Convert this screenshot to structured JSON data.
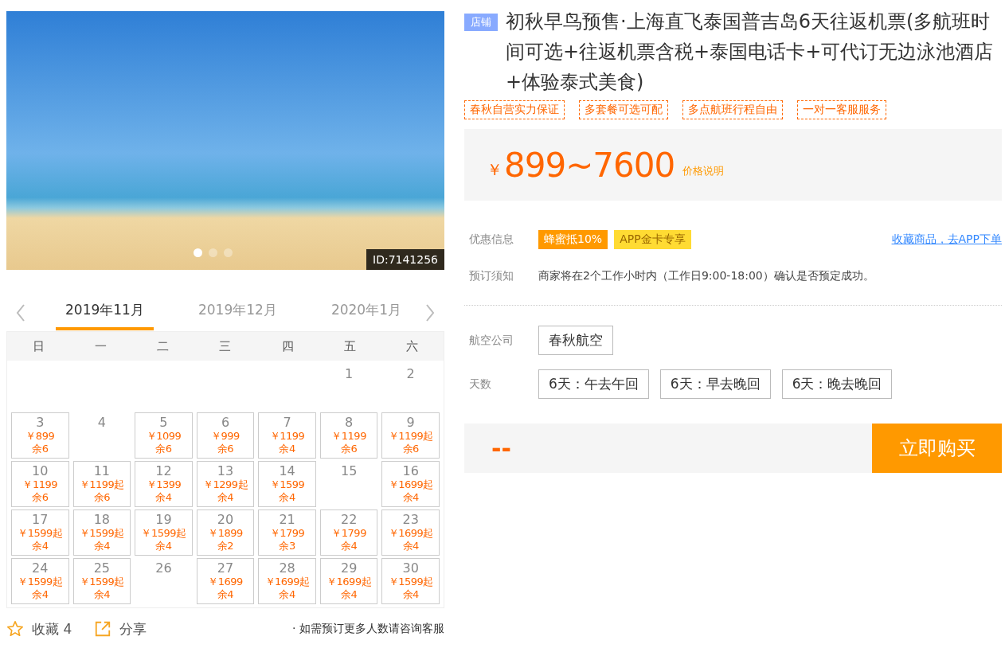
{
  "gallery": {
    "dots": [
      {
        "selected": true
      },
      {
        "selected": false
      },
      {
        "selected": false
      }
    ],
    "id_label": "ID:7141256"
  },
  "calendar": {
    "months": [
      {
        "label": "2019年11月",
        "selected": true
      },
      {
        "label": "2019年12月",
        "selected": false
      },
      {
        "label": "2020年1月",
        "selected": false
      }
    ],
    "weekdays": [
      "日",
      "一",
      "二",
      "三",
      "四",
      "五",
      "六"
    ],
    "weeks": [
      [
        {
          "day": "1"
        },
        {
          "day": "2"
        }
      ],
      [
        {
          "day": "3",
          "price": "￥899",
          "stock": "余6"
        },
        {
          "day": "4"
        },
        {
          "day": "5",
          "price": "￥1099",
          "stock": "余6"
        },
        {
          "day": "6",
          "price": "￥999",
          "stock": "余6"
        },
        {
          "day": "7",
          "price": "￥1199",
          "stock": "余4"
        },
        {
          "day": "8",
          "price": "￥1199",
          "stock": "余6"
        },
        {
          "day": "9",
          "price": "￥1199起",
          "stock": "余6"
        }
      ],
      [
        {
          "day": "10",
          "price": "￥1199",
          "stock": "余6"
        },
        {
          "day": "11",
          "price": "￥1199起",
          "stock": "余6"
        },
        {
          "day": "12",
          "price": "￥1399",
          "stock": "余4"
        },
        {
          "day": "13",
          "price": "￥1299起",
          "stock": "余4"
        },
        {
          "day": "14",
          "price": "￥1599",
          "stock": "余4"
        },
        {
          "day": "15"
        },
        {
          "day": "16",
          "price": "￥1699起",
          "stock": "余4"
        }
      ],
      [
        {
          "day": "17",
          "price": "￥1599起",
          "stock": "余4"
        },
        {
          "day": "18",
          "price": "￥1599起",
          "stock": "余4"
        },
        {
          "day": "19",
          "price": "￥1599起",
          "stock": "余4"
        },
        {
          "day": "20",
          "price": "￥1899",
          "stock": "余2"
        },
        {
          "day": "21",
          "price": "￥1799",
          "stock": "余3"
        },
        {
          "day": "22",
          "price": "￥1799",
          "stock": "余4"
        },
        {
          "day": "23",
          "price": "￥1699起",
          "stock": "余4"
        }
      ],
      [
        {
          "day": "24",
          "price": "￥1599起",
          "stock": "余4"
        },
        {
          "day": "25",
          "price": "￥1599起",
          "stock": "余4"
        },
        {
          "day": "26"
        },
        {
          "day": "27",
          "price": "￥1699",
          "stock": "余4"
        },
        {
          "day": "28",
          "price": "￥1699起",
          "stock": "余4"
        },
        {
          "day": "29",
          "price": "￥1699起",
          "stock": "余4"
        },
        {
          "day": "30",
          "price": "￥1599起",
          "stock": "余4"
        }
      ]
    ]
  },
  "actions": {
    "favorite": "收藏 4",
    "share": "分享",
    "note": "· 如需预订更多人数请咨询客服"
  },
  "product": {
    "shop_badge": "店铺",
    "title": "初秋早鸟预售·上海直飞泰国普吉岛6天往返机票(多航班时间可选+往返机票含税+泰国电话卡+可代订无边泳池酒店+体验泰式美食)",
    "tags": [
      "春秋自营实力保证",
      "多套餐可选可配",
      "多点航班行程自由",
      "一对一客服服务"
    ],
    "price": {
      "currency": "￥",
      "range": "899~7600",
      "note": "价格说明"
    },
    "promotions": {
      "label": "优惠信息",
      "badges": [
        {
          "text": "蜂蜜抵10%",
          "kind": "discount"
        },
        {
          "text": "APP金卡专享",
          "kind": "gold"
        }
      ],
      "link": "收藏商品，去APP下单"
    },
    "notice": {
      "label": "预订须知",
      "text": "商家将在2个工作小时内（工作日9:00-18:00）确认是否预定成功。"
    },
    "options": [
      {
        "label": "航空公司",
        "choices": [
          {
            "text": "春秋航空",
            "selected": false
          }
        ]
      },
      {
        "label": "天数",
        "choices": [
          {
            "text": "6天：午去午回",
            "selected": false
          },
          {
            "text": "6天：早去晚回",
            "selected": false
          },
          {
            "text": "6天：晚去晚回",
            "selected": false
          }
        ]
      }
    ],
    "buy": {
      "total": "--",
      "button": "立即购买"
    }
  }
}
